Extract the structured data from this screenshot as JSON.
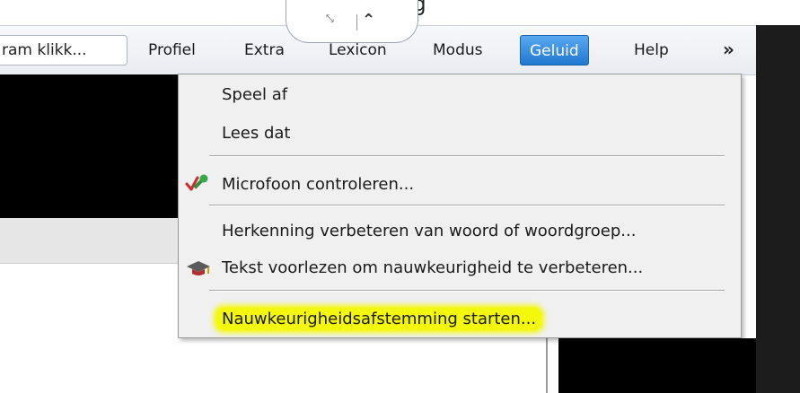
{
  "window": {
    "partial_title": "g"
  },
  "command_box": {
    "text": "ram klikk..."
  },
  "menubar": {
    "items": [
      "Profiel",
      "Extra",
      "Lexicon",
      "Modus",
      "Geluid",
      "Help"
    ],
    "active": "Geluid",
    "overflow_icon": "double-chevron-down-icon"
  },
  "collapse_tab": {
    "expand_icon": "expand-icon",
    "collapse_icon": "chevron-up-icon"
  },
  "dropdown": {
    "items": [
      "Speel af",
      "Lees dat",
      "Microfoon controleren...",
      "Herkenning verbeteren van woord of woordgroep...",
      "Tekst voorlezen om nauwkeurigheid te verbeteren...",
      "Nauwkeurigheidsafstemming starten..."
    ],
    "highlighted_item": "Nauwkeurigheidsafstemming starten...",
    "highlight_color": "#f4f80a"
  },
  "colors": {
    "active_menu": "#2f86dd",
    "menu_bg": "#f0f0f0"
  }
}
